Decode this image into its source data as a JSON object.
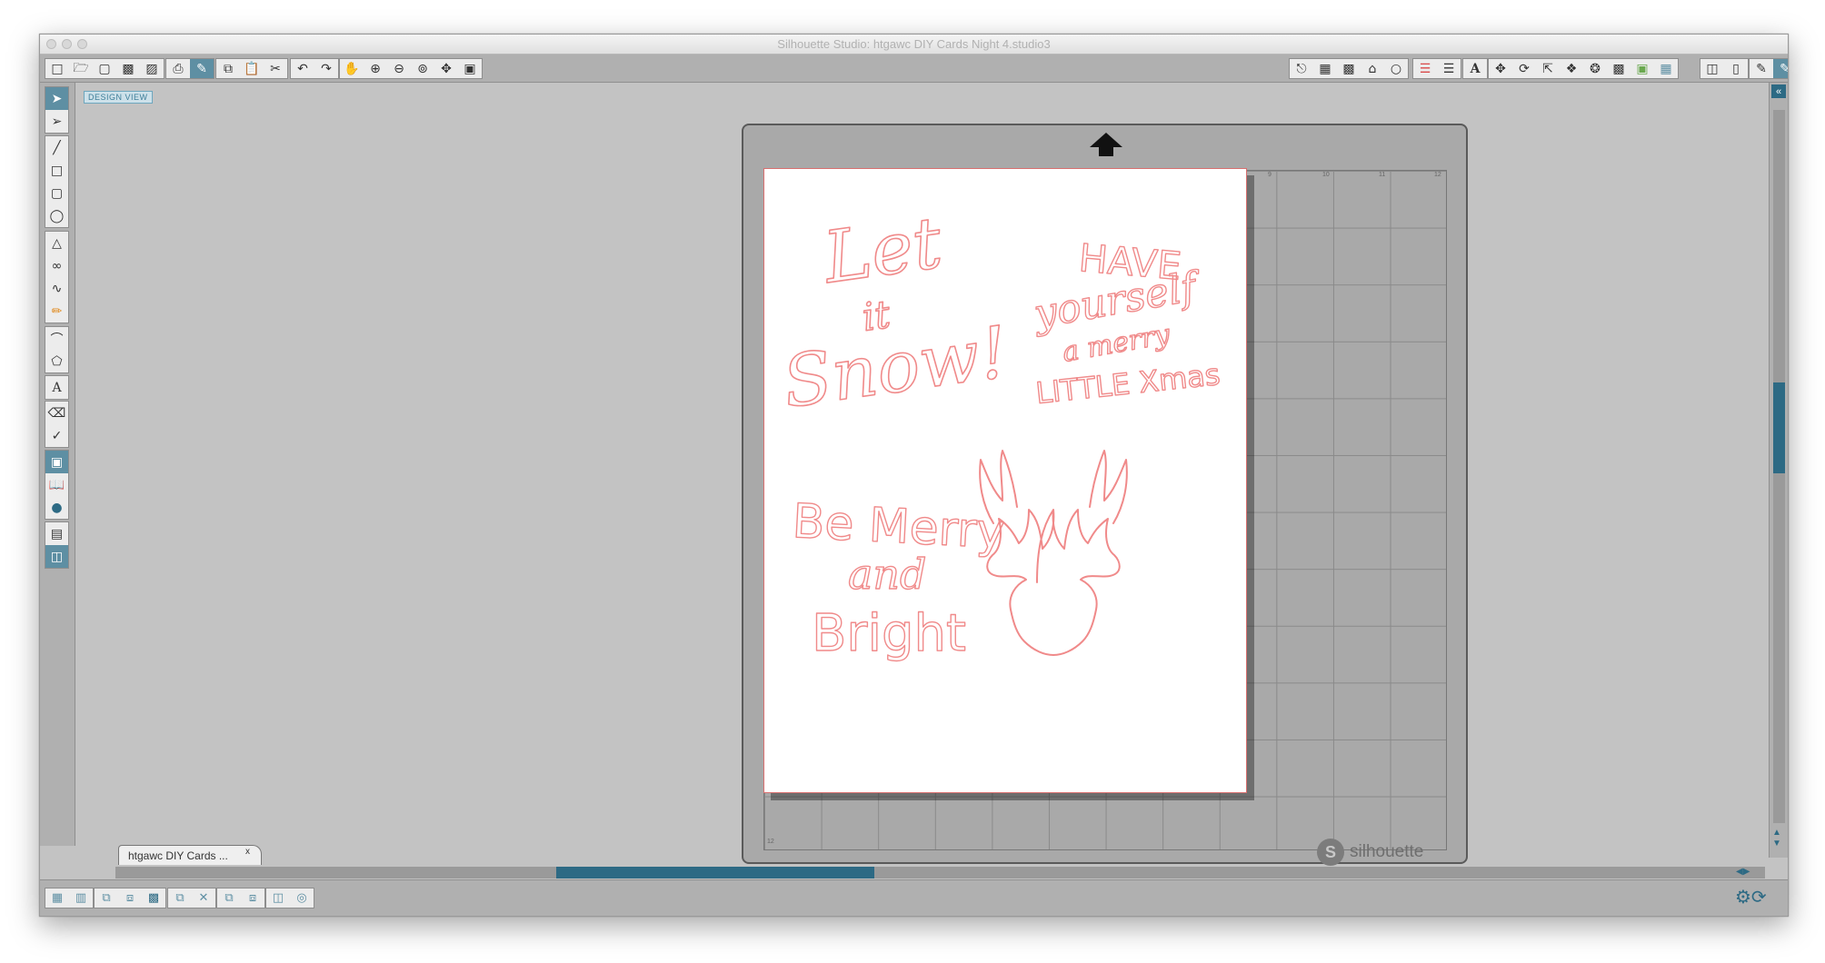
{
  "window": {
    "title": "Silhouette Studio: htgawc DIY Cards Night 4.studio3"
  },
  "canvas": {
    "view_label": "DESIGN VIEW"
  },
  "toolbar": {
    "groups": [
      [
        "new-doc-icon",
        "open-icon",
        "template-icon",
        "save-icon",
        "save-library-icon"
      ],
      [
        "print-icon",
        "send-to-cutter-icon"
      ],
      [
        "copy-icon",
        "paste-icon",
        "cut-icon"
      ],
      [
        "undo-icon",
        "redo-icon"
      ],
      [
        "pan-icon",
        "zoom-in-icon",
        "zoom-out-icon",
        "zoom-select-icon",
        "zoom-drag-icon",
        "fit-to-page-icon"
      ]
    ],
    "right_groups": [
      [
        "page-setup-icon",
        "grid-icon",
        "registration-icon",
        "library-icon",
        "shape-icon"
      ],
      [
        "line-color-icon",
        "line-style-icon"
      ],
      [
        "text-style-icon"
      ],
      [
        "transform-icon",
        "rotate-icon",
        "scale-icon",
        "replicate-icon",
        "offset-icon",
        "trace-icon",
        "fill-color-icon",
        "fill-pattern-icon"
      ],
      [
        "design-store-icon",
        "library-panel-icon"
      ],
      [
        "print-cut-icon",
        "cut-settings-icon"
      ]
    ]
  },
  "document": {
    "tab_label": "htgawc DIY Cards ...",
    "close_glyph": "x"
  },
  "mat": {
    "ruler_top": [
      "9",
      "10",
      "11",
      "12"
    ],
    "ruler_bottom": [
      "12"
    ],
    "brand": {
      "logo_letter": "S",
      "name": "silhouette"
    }
  },
  "artwork": {
    "stroke_color": "#f08a8a",
    "phrases": [
      [
        "Let",
        "it",
        "Snow!"
      ],
      [
        "HAVE",
        "yourself",
        "a merry",
        "LITTLE Xmas"
      ],
      [
        "Be Merry",
        "and",
        "Bright"
      ]
    ],
    "shapes": [
      "deer-head-silhouette"
    ]
  },
  "colors": {
    "accent": "#2d6a84",
    "active_button": "#5e8fa3",
    "workspace": "#c3c3c3"
  }
}
